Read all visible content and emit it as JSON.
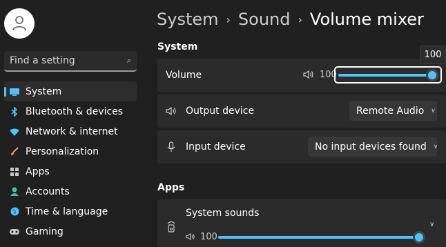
{
  "sidebar": {
    "search_placeholder": "Find a setting",
    "items": [
      {
        "label": "System",
        "icon": "system-icon",
        "color": "#4cc2ff"
      },
      {
        "label": "Bluetooth & devices",
        "icon": "bluetooth-icon",
        "color": "#4cc2ff"
      },
      {
        "label": "Network & internet",
        "icon": "wifi-icon",
        "color": "#4cc2ff"
      },
      {
        "label": "Personalization",
        "icon": "brush-icon",
        "color": "#e8a265"
      },
      {
        "label": "Apps",
        "icon": "apps-icon",
        "color": "#c8c8c8"
      },
      {
        "label": "Accounts",
        "icon": "accounts-icon",
        "color": "#3fc8a8"
      },
      {
        "label": "Time & language",
        "icon": "globe-icon",
        "color": "#4cc2ff"
      },
      {
        "label": "Gaming",
        "icon": "gamepad-icon",
        "color": "#c8c8c8"
      }
    ]
  },
  "header": {
    "crumbs": [
      "System",
      "Sound"
    ],
    "current": "Volume mixer"
  },
  "system": {
    "title": "System",
    "volume_label": "Volume",
    "volume_value": "100",
    "volume_level": 1.0,
    "tooltip": "100",
    "output_label": "Output device",
    "output_value": "Remote Audio",
    "input_label": "Input device",
    "input_value": "No input devices found"
  },
  "apps": {
    "title": "Apps",
    "system_sounds_label": "System sounds",
    "system_sounds_value": "100",
    "system_sounds_level": 1.0
  },
  "colors": {
    "accent": "#4cc2ff",
    "background": "#202020",
    "card": "#2b2b2b"
  }
}
